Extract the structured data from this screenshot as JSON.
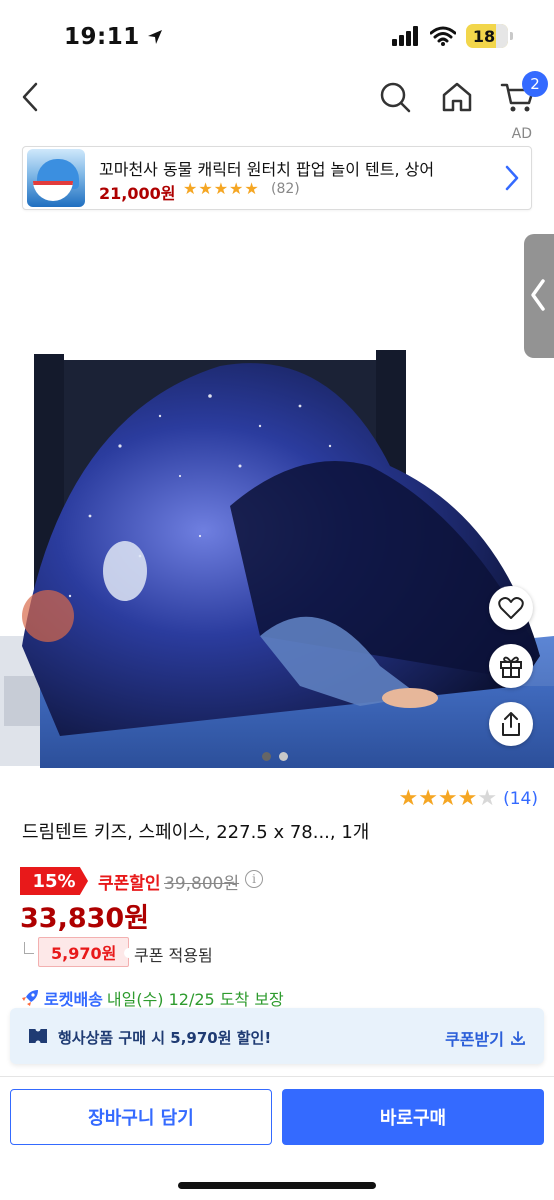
{
  "status_bar": {
    "time": "19:11",
    "battery": "18"
  },
  "header": {
    "cart_count": "2",
    "ad_label": "AD"
  },
  "ad_banner": {
    "title": "꼬마천사 동물 캐릭터 원터치 팝업 놀이 텐트, 상어",
    "price": "21,000원",
    "stars": "★★★★★",
    "review_count": "(82)"
  },
  "gallery": {
    "image_count": 2,
    "active_index": 1
  },
  "product": {
    "rating": 4,
    "stars_on": "★★★★",
    "stars_off": "★",
    "review_count": "(14)",
    "title": "드림텐트 키즈, 스페이스, 227.5 x 78..., 1개",
    "discount_rate": "15%",
    "coupon_discount_label": "쿠폰할인",
    "original_price": "39,800원",
    "final_price": "33,830원",
    "coupon_amount": "5,970원",
    "coupon_applied_label": "쿠폰 적용됨"
  },
  "delivery": {
    "brand": "로켓배송",
    "arrival": "내일(수) 12/25 도착 보장"
  },
  "coupon_bar": {
    "text": "행사상품 구매 시 5,970원 할인!",
    "button": "쿠폰받기"
  },
  "actions": {
    "add_to_cart": "장바구니 담기",
    "buy_now": "바로구매"
  },
  "colors": {
    "accent_blue": "#346aff",
    "price_red": "#ae0000",
    "discount_red": "#e8191a",
    "delivery_green": "#2e9b2e",
    "star": "#f5a623"
  }
}
